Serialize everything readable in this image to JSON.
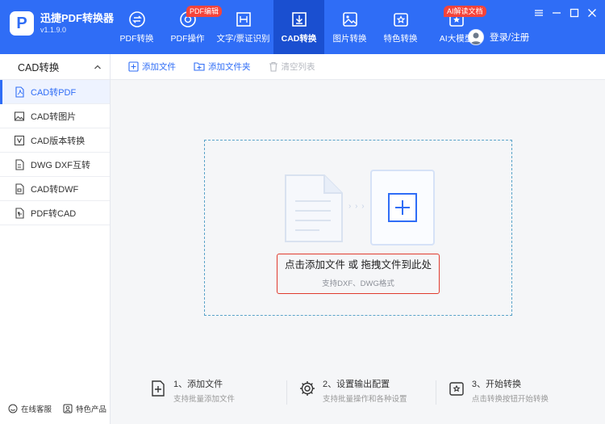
{
  "app": {
    "name": "迅捷PDF转换器",
    "version": "v1.1.9.0",
    "logo_letter": "P"
  },
  "colors": {
    "brand": "#2f6df6",
    "brand_active": "#1a4fd0",
    "badge": "#f5443b",
    "highlight": "#e03b2e"
  },
  "nav": [
    {
      "label": "PDF转换",
      "icon": "pdf-convert-icon"
    },
    {
      "label": "PDF操作",
      "icon": "pdf-operate-icon",
      "badge": "PDF编辑"
    },
    {
      "label": "文字/票证识别",
      "icon": "ocr-icon"
    },
    {
      "label": "CAD转换",
      "icon": "cad-convert-icon",
      "active": true
    },
    {
      "label": "图片转换",
      "icon": "image-convert-icon"
    },
    {
      "label": "特色转换",
      "icon": "special-convert-icon"
    },
    {
      "label": "AI大模型",
      "icon": "ai-model-icon",
      "badge": "AI解读文档"
    }
  ],
  "account": {
    "label": "登录/注册"
  },
  "sidebar": {
    "header": "CAD转换",
    "items": [
      {
        "label": "CAD转PDF",
        "icon": "pdf-file-icon",
        "active": true
      },
      {
        "label": "CAD转图片",
        "icon": "image-file-icon"
      },
      {
        "label": "CAD版本转换",
        "icon": "version-icon"
      },
      {
        "label": "DWG DXF互转",
        "icon": "swap-file-icon"
      },
      {
        "label": "CAD转DWF",
        "icon": "dwf-file-icon"
      },
      {
        "label": "PDF转CAD",
        "icon": "cad-file-icon"
      }
    ],
    "footer": [
      {
        "label": "在线客服",
        "icon": "customer-service-icon"
      },
      {
        "label": "特色产品",
        "icon": "featured-products-icon"
      }
    ]
  },
  "toolbar": {
    "add_file": "添加文件",
    "add_folder": "添加文件夹",
    "clear_list": "清空列表"
  },
  "dropzone": {
    "main": "点击添加文件 或 拖拽文件到此处",
    "sub": "支持DXF、DWG格式"
  },
  "steps": [
    {
      "title": "1、添加文件",
      "desc": "支持批量添加文件",
      "icon": "add-file-icon"
    },
    {
      "title": "2、设置输出配置",
      "desc": "支持批量操作和各种设置",
      "icon": "settings-gear-icon"
    },
    {
      "title": "3、开始转换",
      "desc": "点击转换按钮开始转换",
      "icon": "convert-icon"
    }
  ]
}
